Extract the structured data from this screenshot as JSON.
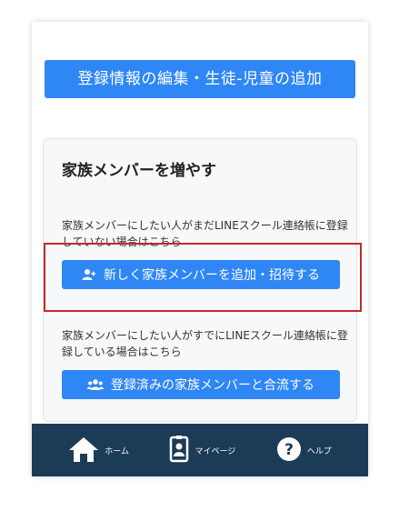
{
  "top_button": {
    "label": "登録情報の編集・生徒-児童の追加"
  },
  "family_card": {
    "title": "家族メンバーを増やす",
    "invite_desc": "家族メンバーにしたい人がまだLINEスクール連絡帳に登録していない場合はこちら",
    "invite_button": "新しく家族メンバーを追加・招待する",
    "join_desc": "家族メンバーにしたい人がすでにLINEスクール連絡帳に登録している場合はこちら",
    "join_button": "登録済みの家族メンバーと合流する"
  },
  "footer": {
    "home": "ホーム",
    "mypage": "マイページ",
    "help": "ヘルプ"
  },
  "colors": {
    "primary": "#2f86f5",
    "footer_bg": "#1b3b57",
    "highlight": "#c22a2a"
  },
  "icons": [
    "user-plus-icon",
    "users-icon",
    "home-icon",
    "id-badge-icon",
    "help-circle-icon"
  ]
}
